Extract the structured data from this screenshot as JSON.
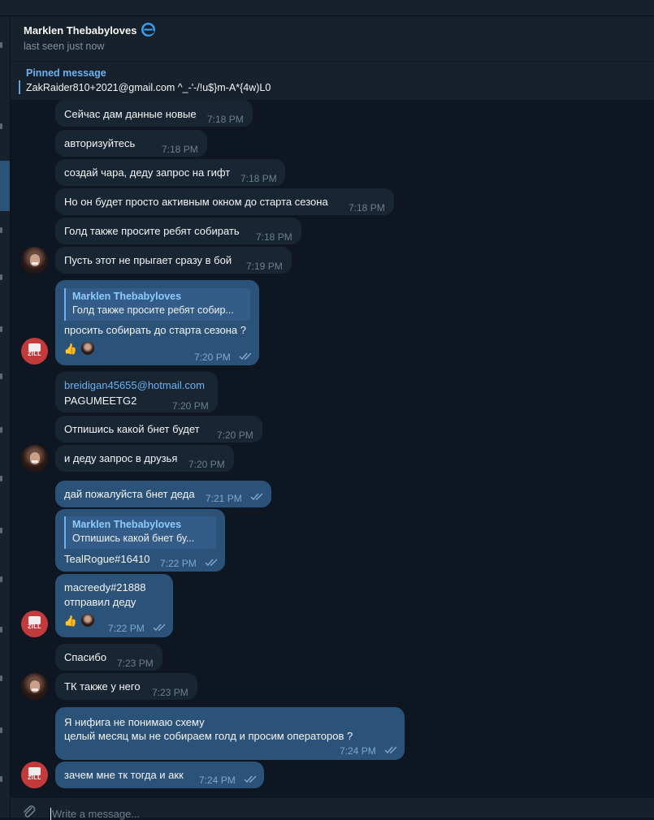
{
  "header": {
    "contact_name": "Marklen Thebabyloves",
    "status": "last seen just now",
    "badge_icon": "edge-browser-icon"
  },
  "pinned": {
    "title": "Pinned message",
    "text": "ZakRaider810+2021@gmail.com ^_-'-/!u$}m-A*{4w)L0"
  },
  "messages": [
    {
      "text": "Сейчас дам данные новые",
      "time": "7:18 PM"
    },
    {
      "text": "авторизуйтесь",
      "time": "7:18 PM"
    },
    {
      "text": "создай чара, деду запрос на гифт",
      "time": "7:18 PM"
    },
    {
      "text": "Но он будет просто активным окном до старта сезона",
      "time": "7:18 PM"
    },
    {
      "text": "Голд также просите ребят собирать",
      "time": "7:18 PM"
    },
    {
      "text": "Пусть этот не прыгает сразу в бой",
      "time": "7:19 PM"
    },
    {
      "reply_name": "Marklen Thebabyloves",
      "reply_text": "Голд также просите ребят собир...",
      "text": "просить собирать до старта сезона ?",
      "time": "7:20 PM",
      "reactions": [
        "thumbs-up",
        "avatar"
      ]
    },
    {
      "link": "breidigan45655@hotmail.com",
      "text": "PAGUMEETG2",
      "time": "7:20 PM"
    },
    {
      "text": "Отпишись какой бнет будет",
      "time": "7:20 PM"
    },
    {
      "text": "и деду запрос в друзья",
      "time": "7:20 PM"
    },
    {
      "text": "дай пожалуйста бнет деда",
      "time": "7:21 PM"
    },
    {
      "reply_name": "Marklen Thebabyloves",
      "reply_text": "Отпишись какой бнет бу...",
      "text": "TealRogue#16410",
      "time": "7:22 PM"
    },
    {
      "line1": "macreedy#21888",
      "text": "отправил деду",
      "time": "7:22 PM",
      "reactions": [
        "thumbs-up",
        "avatar"
      ]
    },
    {
      "text": "Спасибо",
      "time": "7:23 PM"
    },
    {
      "text": "ТК также у него",
      "time": "7:23 PM"
    },
    {
      "line1": "Я нифига не понимаю схему",
      "text": "целый месяц мы не собираем голд и просим операторов ?",
      "time": "7:24 PM"
    },
    {
      "text": "зачем мне тк тогда и акк",
      "time": "7:24 PM"
    }
  ],
  "avatars": {
    "contact_label": "contact-avatar",
    "self_label": "ZILL"
  },
  "compose": {
    "placeholder": "Write a message..."
  },
  "colors": {
    "background": "#0e1621",
    "incoming_bubble": "#182533",
    "outgoing_bubble": "#2b5278",
    "accent": "#6ab2f2"
  }
}
